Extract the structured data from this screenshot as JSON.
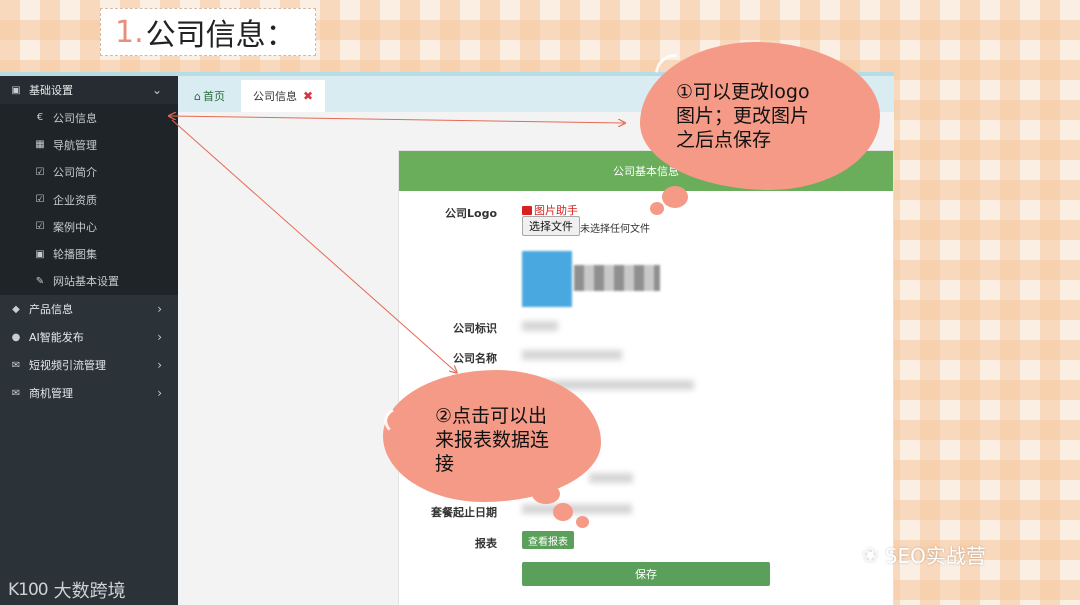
{
  "slide": {
    "number": "1.",
    "title": "公司信息："
  },
  "sidebar": {
    "top_group": {
      "label": "基础设置",
      "icon": "settings-icon"
    },
    "items": [
      {
        "icon_char": "€",
        "label": "公司信息"
      },
      {
        "icon_char": "▦",
        "label": "导航管理"
      },
      {
        "icon_char": "☑",
        "label": "公司简介"
      },
      {
        "icon_char": "☑",
        "label": "企业资质"
      },
      {
        "icon_char": "☑",
        "label": "案例中心"
      },
      {
        "icon_char": "▣",
        "label": "轮播图集"
      },
      {
        "icon_char": "✎",
        "label": "网站基本设置"
      }
    ],
    "groups": [
      {
        "icon_char": "◆",
        "label": "产品信息"
      },
      {
        "icon_char": "●",
        "label": "AI智能发布"
      },
      {
        "icon_char": "✉",
        "label": "短视频引流管理"
      },
      {
        "icon_char": "✉",
        "label": "商机管理"
      }
    ],
    "brand": {
      "mark": "K100",
      "text": "大数跨境"
    }
  },
  "tabs": {
    "home": "首页",
    "active": "公司信息"
  },
  "card": {
    "header": "公司基本信息",
    "logo_label": "公司Logo",
    "helper": "图片助手",
    "file_button": "选择文件",
    "file_status": "未选择任何文件",
    "label_mark": "公司标识",
    "label_name": "公司名称",
    "label_partial": "公司",
    "label_dates": "套餐起止日期",
    "label_report": "报表",
    "report_button": "查看报表",
    "save_button": "保存"
  },
  "callouts": {
    "one": [
      "①可以更改logo",
      "图片；更改图片",
      "之后点保存"
    ],
    "two": [
      "②点击可以出",
      "来报表数据连",
      "接"
    ]
  },
  "watermark": "SEO实战营",
  "colors": {
    "sidebar": "#2b3238",
    "accent_green": "#6aad5b",
    "bubble": "#f59a86"
  }
}
